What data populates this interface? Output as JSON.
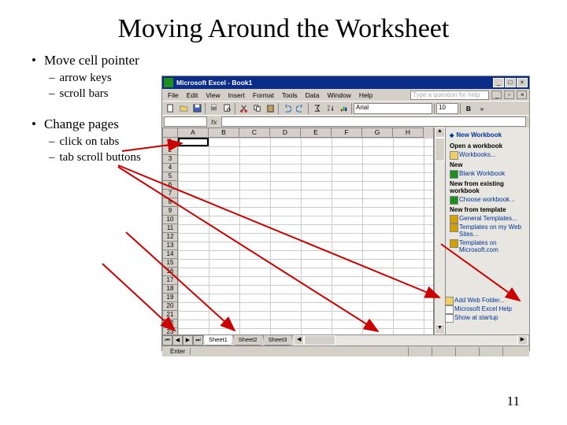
{
  "slide": {
    "title": "Moving Around the Worksheet",
    "bullet1": "Move cell pointer",
    "sub1a": "arrow keys",
    "sub1b": "scroll bars",
    "bullet2": "Change pages",
    "sub2a": "click on tabs",
    "sub2b": "tab scroll buttons",
    "page_number": "11"
  },
  "excel": {
    "title": "Microsoft Excel - Book1",
    "menus": [
      "File",
      "Edit",
      "View",
      "Insert",
      "Format",
      "Tools",
      "Data",
      "Window",
      "Help"
    ],
    "help_placeholder": "Type a question for help",
    "font": "Arial",
    "size": "10",
    "columns": [
      "A",
      "B",
      "C",
      "D",
      "E",
      "F",
      "G",
      "H"
    ],
    "rows": [
      "1",
      "2",
      "3",
      "4",
      "5",
      "6",
      "7",
      "8",
      "9",
      "10",
      "11",
      "12",
      "13",
      "14",
      "15",
      "16",
      "17",
      "18",
      "19",
      "20",
      "21",
      "22",
      "23"
    ],
    "sheet_tabs": [
      "Sheet1",
      "Sheet2",
      "Sheet3"
    ],
    "status": "Enter",
    "task_pane": {
      "header": "New Workbook",
      "open_section": "Open a workbook",
      "open_items": [
        "Workbooks..."
      ],
      "new_section": "New",
      "new_items": [
        "Blank Workbook"
      ],
      "existing_section": "New from existing workbook",
      "existing_items": [
        "Choose workbook..."
      ],
      "template_section": "New from template",
      "template_items": [
        "General Templates...",
        "Templates on my Web Sites...",
        "Templates on Microsoft.com"
      ],
      "bottom_items": [
        "Add Web Folder...",
        "Microsoft Excel Help",
        "Show at startup"
      ]
    }
  }
}
